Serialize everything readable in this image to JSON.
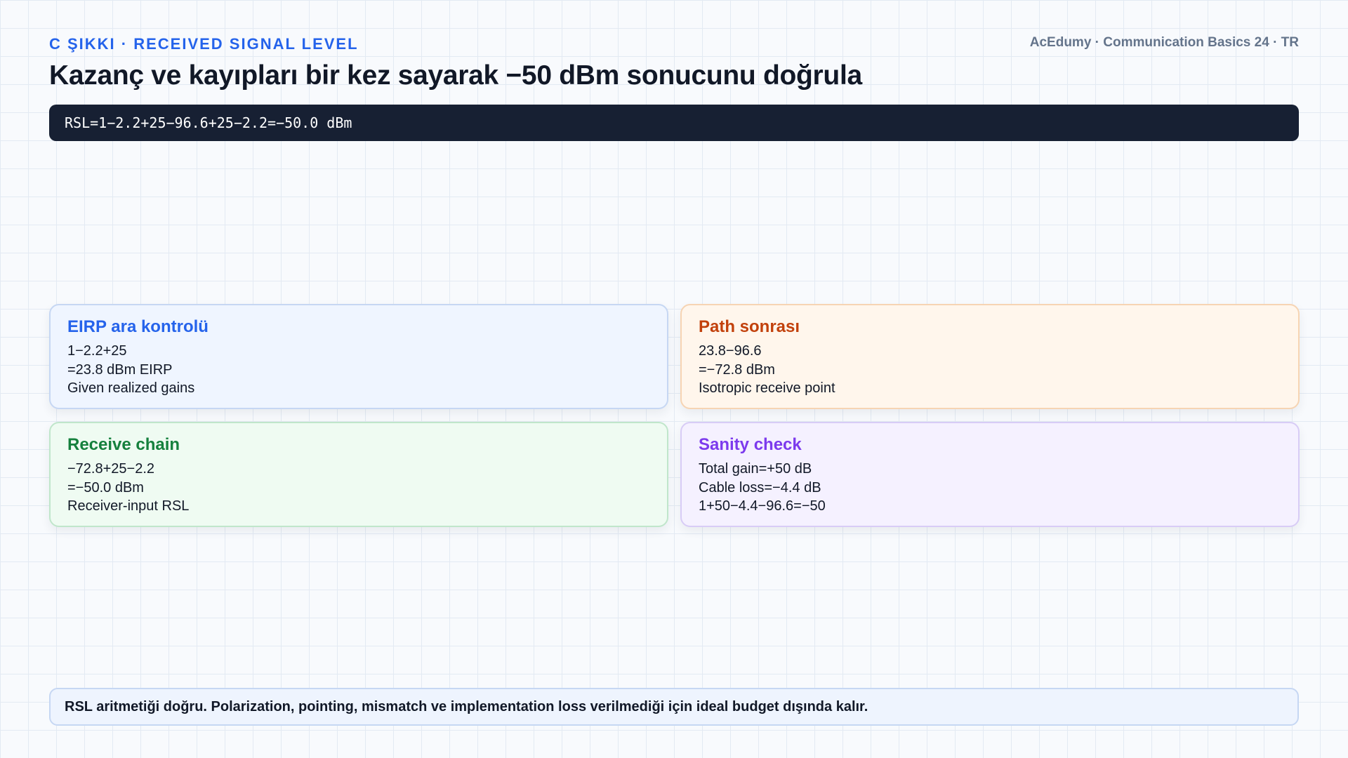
{
  "header": {
    "kicker": "C ŞIKKI · RECEIVED SIGNAL LEVEL",
    "brand": "AcEdumy · Communication Basics 24 · TR",
    "title": "Kazanç ve kayıpları bir kez sayarak −50 dBm sonucunu doğrula"
  },
  "formula": "RSL=1−2.2+25−96.6+25−2.2=−50.0 dBm",
  "cards": [
    {
      "title": "EIRP ara kontrolü",
      "lines": [
        "1−2.2+25",
        "=23.8 dBm EIRP",
        "Given realized gains"
      ],
      "accent": "#2563eb"
    },
    {
      "title": "Path sonrası",
      "lines": [
        "23.8−96.6",
        "=−72.8 dBm",
        "Isotropic receive point"
      ],
      "accent": "#c2410c"
    },
    {
      "title": "Receive chain",
      "lines": [
        "−72.8+25−2.2",
        "=−50.0 dBm",
        "Receiver-input RSL"
      ],
      "accent": "#15803d"
    },
    {
      "title": "Sanity check",
      "lines": [
        "Total gain=+50 dB",
        "Cable loss=−4.4 dB",
        "1+50−4.4−96.6=−50"
      ],
      "accent": "#7c3aed"
    }
  ],
  "footer": {
    "note": "RSL aritmetiği doğru. Polarization, pointing, mismatch ve implementation loss verilmediği için ideal budget dışında kalır."
  }
}
